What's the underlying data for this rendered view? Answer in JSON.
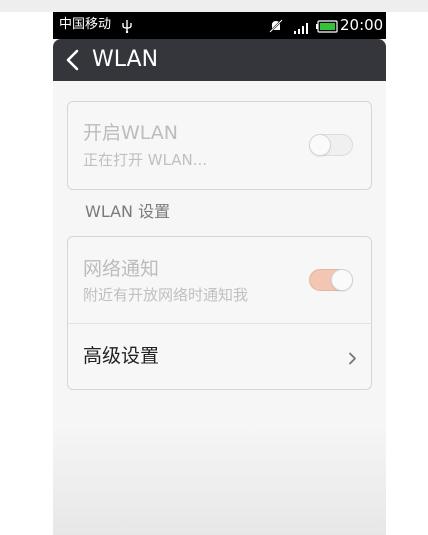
{
  "status_bar": {
    "carrier": "中国移动",
    "time": "20:00",
    "icons": [
      "usb-icon",
      "mute-icon",
      "signal-icon",
      "battery-icon"
    ],
    "battery_color": "#35c23a"
  },
  "title_bar": {
    "title": "WLAN",
    "back_icon": "back-chevron-icon"
  },
  "wlan_card": {
    "title": "开启WLAN",
    "subtitle": "正在打开 WLAN...",
    "toggle_state": "off"
  },
  "section_header": "WLAN 设置",
  "network_card": {
    "notify": {
      "title": "网络通知",
      "subtitle": "附近有开放网络时通知我",
      "toggle_state": "on"
    },
    "advanced": {
      "title": "高级设置",
      "icon": "chevron-right-icon"
    }
  },
  "colors": {
    "title_bar": "#34363b",
    "toggle_on": "#f3c5b3",
    "disabled_text": "#bcbcbc"
  }
}
